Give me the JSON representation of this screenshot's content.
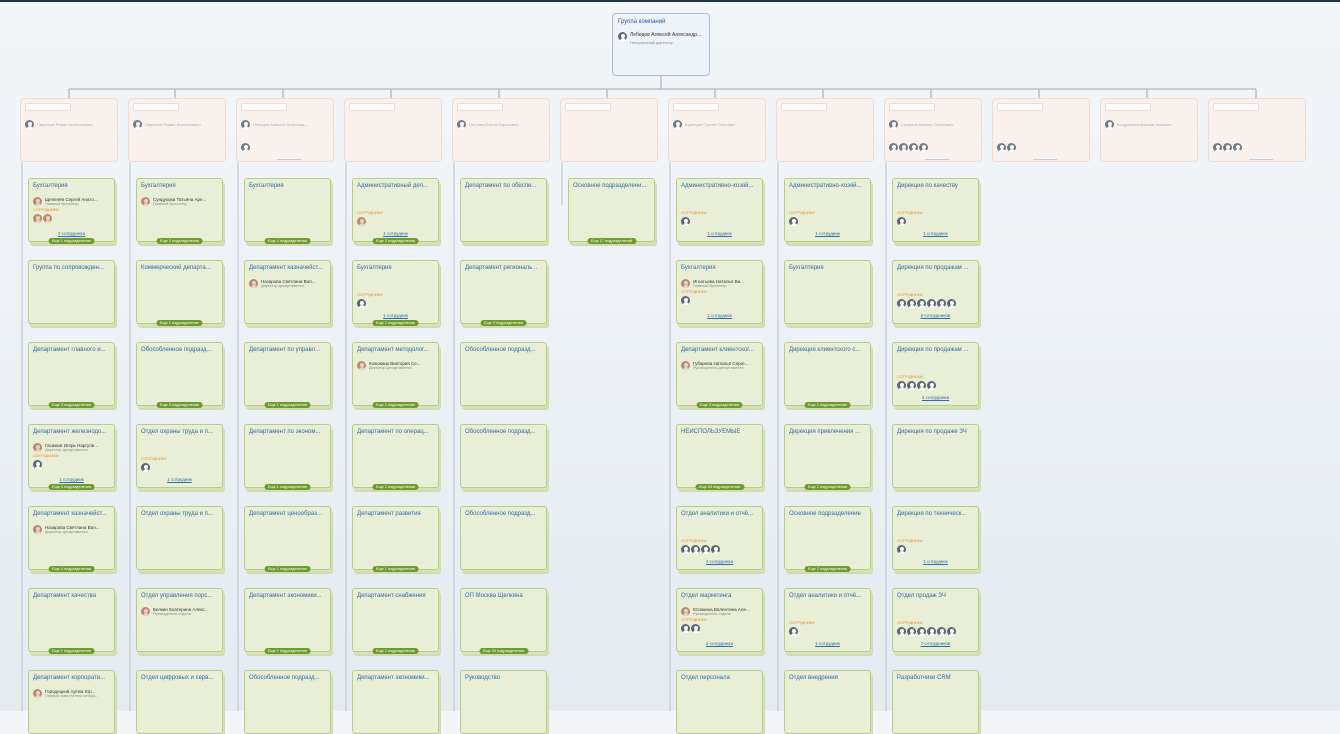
{
  "root": {
    "title": "Группа компаний",
    "manager": "Лебедев Алексей Александр...",
    "position": "Генеральный директор"
  },
  "labels": {
    "employees": "СОТРУДНИКИ"
  },
  "columns": [
    {
      "cards": [
        {
          "title": "Бухгалтерия",
          "mgr": "Щепелёв Сергей Анато...",
          "pos": "Главный бухгалтер",
          "label": true,
          "avatars": [
            "photo",
            "photo"
          ],
          "count": "2 сотрудника",
          "badge": "Еще 1 подразделение"
        },
        {
          "title": "Группа по сопровожден...",
          "badge": ""
        },
        {
          "title": "Департамент главного и...",
          "badge": "Еще 3 подразделения"
        },
        {
          "title": "Департамент железнодо...",
          "mgr": "Гасимов Игорь Наргули...",
          "pos": "Директор департамента",
          "label": true,
          "avatars": [
            "a"
          ],
          "count": "1 сотрудник",
          "badge": "Еще 3 подразделения"
        },
        {
          "title": "Департамент казначейст...",
          "mgr": "Назарова Светлана Вал...",
          "pos": "Директор департамента",
          "badge": "Еще 4 подразделения"
        },
        {
          "title": "Департамент качества",
          "badge": "Еще 1 подразделение"
        },
        {
          "title": "Департамент корпорати...",
          "mgr": "Городецкий Артем Юр...",
          "pos": "Первый заместитель генера...",
          "badge": ""
        }
      ]
    },
    {
      "cards": [
        {
          "title": "Бухгалтерия",
          "mgr": "Сундукова Татьяна Аре...",
          "pos": "Главный бухгалтер",
          "badge": "Еще 3 подразделения"
        },
        {
          "title": "Коммерческий департа...",
          "badge": "Еще 1 подразделение"
        },
        {
          "title": "Обособленное подразд...",
          "badge": "Еще 3 подразделения"
        },
        {
          "title": "Отдел охраны труда и п...",
          "label": true,
          "avatars": [
            "a"
          ],
          "count": "1 сотрудник",
          "badge": ""
        },
        {
          "title": "Отдел охраны труда и п...",
          "badge": ""
        },
        {
          "title": "Отдел управления порс...",
          "mgr": "Белкин Екатерина Алекс...",
          "pos": "Руководитель отдела",
          "badge": ""
        },
        {
          "title": "Отдел цифровых и серв...",
          "badge": ""
        }
      ]
    },
    {
      "cards": [
        {
          "title": "Бухгалтерия",
          "badge": "Еще 4 подразделения"
        },
        {
          "title": "Департамент казначейст...",
          "mgr": "Назарова Светлана Вал...",
          "pos": "Директор департамента",
          "badge": ""
        },
        {
          "title": "Департамент по управл...",
          "badge": "Еще 1 подразделение"
        },
        {
          "title": "Департамент по эконом...",
          "badge": "Еще 1 подразделение"
        },
        {
          "title": "Департамент ценообраз...",
          "badge": "Еще 1 подразделение"
        },
        {
          "title": "Департамент экономики...",
          "badge": "Еще 1 подразделение"
        },
        {
          "title": "Обособленное подразд...",
          "badge": ""
        }
      ]
    },
    {
      "cards": [
        {
          "title": "Административный деп...",
          "label": true,
          "avatars": [
            "photo"
          ],
          "count": "1 сотрудник",
          "badge": "Еще 3 подразделения"
        },
        {
          "title": "Бухгалтерия",
          "label": true,
          "avatars": [
            "a"
          ],
          "count": "1 сотрудник",
          "badge": "Еще 2 подразделения"
        },
        {
          "title": "Департамент методолог...",
          "mgr": "Кожокина Виктория Се...",
          "pos": "Директор департамента",
          "badge": "Еще 1 подразделение"
        },
        {
          "title": "Департамент по операц...",
          "badge": "Еще 2 подразделения"
        },
        {
          "title": "Департамент развития",
          "badge": "Еще 1 подразделение"
        },
        {
          "title": "Департамент снабжения",
          "badge": "Еще 2 подразделения"
        },
        {
          "title": "Департамент экономики...",
          "badge": ""
        }
      ]
    },
    {
      "cards": [
        {
          "title": "Департамент по обеспе...",
          "badge": ""
        },
        {
          "title": "Департамент региональ...",
          "badge": "Еще 3 подразделения"
        },
        {
          "title": "Обособленное подразд...",
          "badge": ""
        },
        {
          "title": "Обособленное подразд...",
          "badge": ""
        },
        {
          "title": "Обособленное подразд...",
          "badge": ""
        },
        {
          "title": "ОП Москва Щелкина",
          "badge": "Еще 33 подразделения"
        },
        {
          "title": "Руководство",
          "badge": ""
        }
      ]
    },
    {
      "cards": [
        {
          "title": "Основное подразделени...",
          "badge": "Еще 17 подразделений"
        }
      ]
    },
    {
      "cards": [
        {
          "title": "Административно-хозяй...",
          "label": true,
          "avatars": [
            "a"
          ],
          "count": "1 сотрудник",
          "badge": ""
        },
        {
          "title": "Бухгалтерия",
          "mgr": "Игнатьева Наталья Ви...",
          "pos": "Главный бухгалтер",
          "label": true,
          "avatars": [
            "a"
          ],
          "count": "1 сотрудник",
          "badge": ""
        },
        {
          "title": "Департамент клиентског...",
          "mgr": "Губарева Наталья Серге...",
          "pos": "Руководитель департамента",
          "badge": "Еще 3 подразделения"
        },
        {
          "title": "НЕИСПОЛЬЗУЕМЫЕ",
          "badge": "Еще 43 подразделения"
        },
        {
          "title": "Отдел аналитики и отчё...",
          "label": true,
          "avatars": [
            "a",
            "a",
            "a",
            "a"
          ],
          "count": "4 сотрудника",
          "badge": ""
        },
        {
          "title": "Отдел маркетинга",
          "mgr": "Юсюкина Валентина Але...",
          "pos": "Руководитель отдела",
          "label": true,
          "avatars": [
            "a",
            "a"
          ],
          "count": "2 сотрудника",
          "badge": ""
        },
        {
          "title": "Отдел персонала",
          "badge": ""
        }
      ]
    },
    {
      "cards": [
        {
          "title": "Административно-хозяй...",
          "label": true,
          "avatars": [
            "a"
          ],
          "count": "1 сотрудник",
          "badge": ""
        },
        {
          "title": "Бухгалтерия",
          "badge": ""
        },
        {
          "title": "Дирекция клиентского с...",
          "badge": "Еще 1 подразделение"
        },
        {
          "title": "Дирекция привлечения ...",
          "badge": "Еще 2 подразделения"
        },
        {
          "title": "Основное подразделение",
          "badge": "Еще 2 подразделения"
        },
        {
          "title": "Отдел аналитики и отчё...",
          "label": true,
          "avatars": [
            "a"
          ],
          "count": "1 сотрудник",
          "badge": ""
        },
        {
          "title": "Отдел внедрения",
          "badge": ""
        }
      ]
    },
    {
      "cards": [
        {
          "title": "Дирекция по качеству",
          "label": true,
          "avatars": [
            "a"
          ],
          "count": "1 сотрудник",
          "badge": ""
        },
        {
          "title": "Дирекция по продажам ...",
          "label": true,
          "avatars": [
            "a",
            "a",
            "a",
            "a",
            "a",
            "a"
          ],
          "count": "6 сотрудников",
          "badge": ""
        },
        {
          "title": "Дирекция по продажам ...",
          "label": true,
          "avatars": [
            "a",
            "a",
            "a",
            "a"
          ],
          "count": "4 сотрудника",
          "badge": ""
        },
        {
          "title": "Дирекция по продаже ЗЧ",
          "badge": ""
        },
        {
          "title": "Дирекция по техническ...",
          "label": true,
          "avatars": [
            "a"
          ],
          "count": "1 сотрудник",
          "badge": ""
        },
        {
          "title": "Отдел продаж ЗЧ",
          "label": true,
          "avatars": [
            "a",
            "a",
            "a",
            "a",
            "a",
            "a"
          ],
          "count": "7 сотрудников",
          "badge": ""
        },
        {
          "title": "Разработчики CRM",
          "badge": ""
        }
      ]
    }
  ],
  "top_units": [
    {
      "avatars": 0,
      "manager": "Гаврилов Роман Анатольевич"
    },
    {
      "avatars": 0,
      "manager": "Гаврилов Роман Анатольевич"
    },
    {
      "avatars": 1,
      "manager": "Лебедев Алексей Александ..."
    },
    {
      "avatars": 0,
      "manager": ""
    },
    {
      "avatars": 0,
      "manager": "Пестова Елена Борисовна"
    },
    {
      "avatars": 0,
      "manager": ""
    },
    {
      "avatars": 0,
      "manager": "Кузнецов Сергей Олегович"
    },
    {
      "avatars": 0,
      "manager": ""
    },
    {
      "avatars": 4,
      "manager": "Смирнов Кирилл Сергеевич"
    },
    {
      "avatars": 2,
      "manager": ""
    },
    {
      "avatars": 0,
      "manager": "Кондратьев Максим Алексан..."
    },
    {
      "avatars": 3,
      "manager": ""
    }
  ]
}
